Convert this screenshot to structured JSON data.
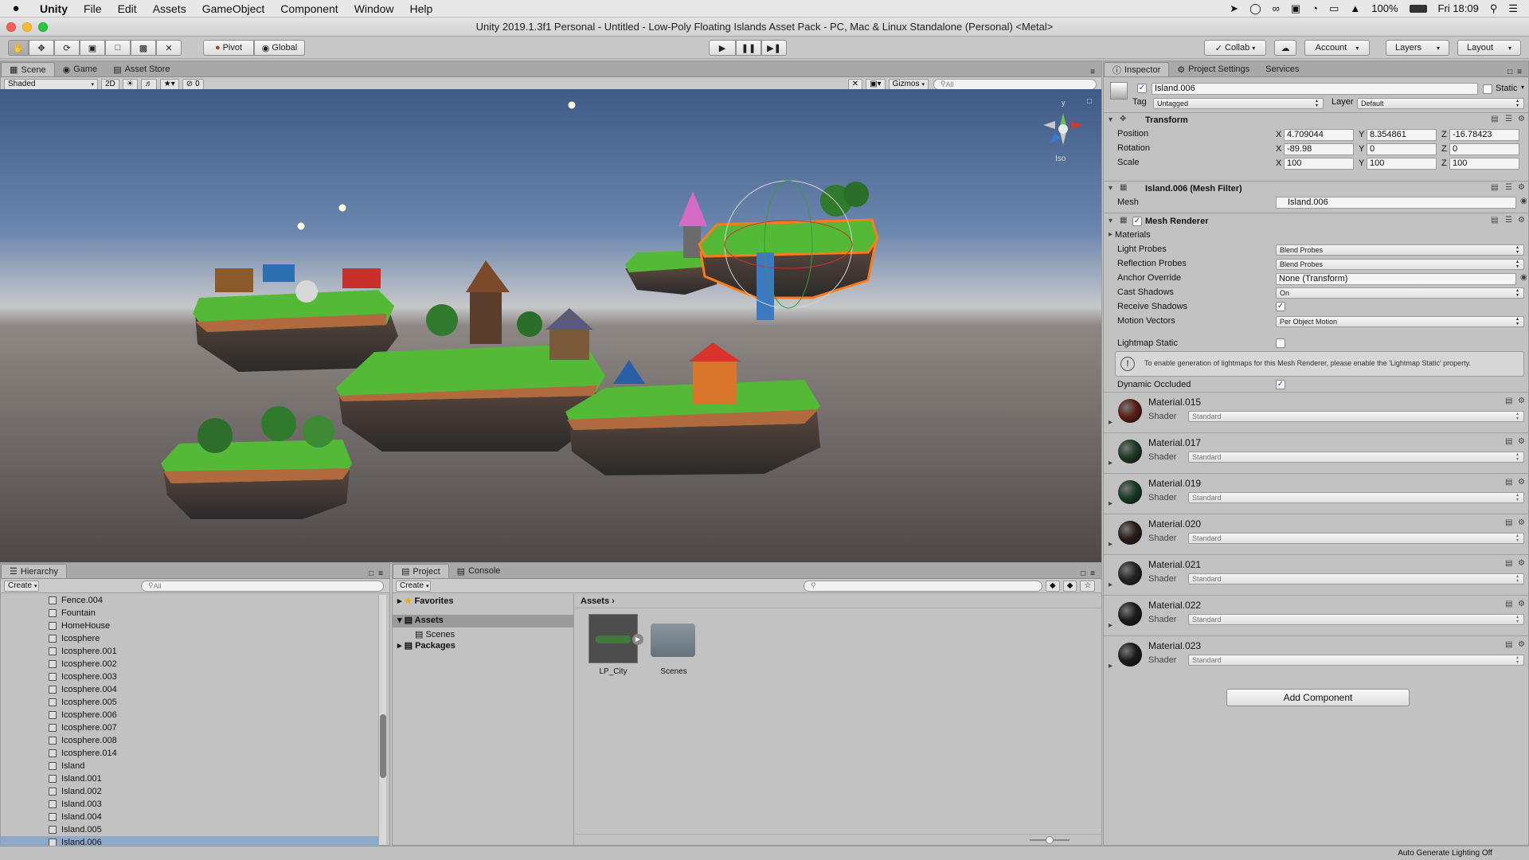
{
  "menubar": {
    "apple": "",
    "app": "Unity",
    "items": [
      "File",
      "Edit",
      "Assets",
      "GameObject",
      "Component",
      "Window",
      "Help"
    ],
    "battery": "100%",
    "clock": "Fri 18:09"
  },
  "window_title": "Unity 2019.1.3f1 Personal - Untitled - Low-Poly Floating Islands Asset Pack - PC, Mac & Linux Standalone (Personal) <Metal>",
  "toolbar": {
    "pivot": "Pivot",
    "global": "Global",
    "collab": "Collab",
    "account": "Account",
    "layers": "Layers",
    "layout": "Layout"
  },
  "scene_tabs": {
    "scene": "Scene",
    "game": "Game",
    "asset_store": "Asset Store"
  },
  "scene_bar": {
    "draw_mode": "Shaded",
    "mode_2d": "2D",
    "hidden_count": "0",
    "gizmos": "Gizmos",
    "search": "All",
    "persp": "Iso",
    "gizmo_y": "y"
  },
  "hierarchy": {
    "tab": "Hierarchy",
    "create": "Create",
    "search": "All",
    "items": [
      "Fence.004",
      "Fountain",
      "HomeHouse",
      "Icosphere",
      "Icosphere.001",
      "Icosphere.002",
      "Icosphere.003",
      "Icosphere.004",
      "Icosphere.005",
      "Icosphere.006",
      "Icosphere.007",
      "Icosphere.008",
      "Icosphere.014",
      "Island",
      "Island.001",
      "Island.002",
      "Island.003",
      "Island.004",
      "Island.005",
      "Island.006"
    ],
    "selected_index": 19
  },
  "project": {
    "tab_project": "Project",
    "tab_console": "Console",
    "create": "Create",
    "favorites": "Favorites",
    "assets": "Assets",
    "scenes": "Scenes",
    "packages": "Packages",
    "breadcrumb": "Assets",
    "items": [
      "LP_City",
      "Scenes"
    ]
  },
  "inspector": {
    "tabs": [
      "Inspector",
      "Project Settings",
      "Services"
    ],
    "object_name": "Island.006",
    "static": "Static",
    "tag_label": "Tag",
    "tag": "Untagged",
    "layer_label": "Layer",
    "layer": "Default",
    "transform": {
      "title": "Transform",
      "position_label": "Position",
      "rotation_label": "Rotation",
      "scale_label": "Scale",
      "position": [
        "4.709044",
        "8.354861",
        "-16.78423"
      ],
      "rotation": [
        "-89.98",
        "0",
        "0"
      ],
      "scale": [
        "100",
        "100",
        "100"
      ]
    },
    "mesh_filter": {
      "title": "Island.006 (Mesh Filter)",
      "mesh_label": "Mesh",
      "mesh": "Island.006"
    },
    "mesh_renderer": {
      "title": "Mesh Renderer",
      "materials": "Materials",
      "light_probes_label": "Light Probes",
      "light_probes": "Blend Probes",
      "reflection_probes_label": "Reflection Probes",
      "reflection_probes": "Blend Probes",
      "anchor_label": "Anchor Override",
      "anchor": "None (Transform)",
      "cast_label": "Cast Shadows",
      "cast": "On",
      "receive_label": "Receive Shadows",
      "motion_label": "Motion Vectors",
      "motion": "Per Object Motion",
      "lightmap_label": "Lightmap Static",
      "info": "To enable generation of lightmaps for this Mesh Renderer, please enable the 'Lightmap Static' property.",
      "occluded_label": "Dynamic Occluded"
    },
    "shader_label": "Shader",
    "materials": [
      {
        "name": "Material.015",
        "shader": "Standard",
        "color": "#5a1f14"
      },
      {
        "name": "Material.017",
        "shader": "Standard",
        "color": "#1c3a22"
      },
      {
        "name": "Material.019",
        "shader": "Standard",
        "color": "#183a23"
      },
      {
        "name": "Material.020",
        "shader": "Standard",
        "color": "#2a1d17"
      },
      {
        "name": "Material.021",
        "shader": "Standard",
        "color": "#232323"
      },
      {
        "name": "Material.022",
        "shader": "Standard",
        "color": "#1c1c1c"
      },
      {
        "name": "Material.023",
        "shader": "Standard",
        "color": "#1b1b1b"
      }
    ],
    "add_component": "Add Component",
    "axes": [
      "X",
      "Y",
      "Z"
    ]
  },
  "status": "Auto Generate Lighting Off"
}
